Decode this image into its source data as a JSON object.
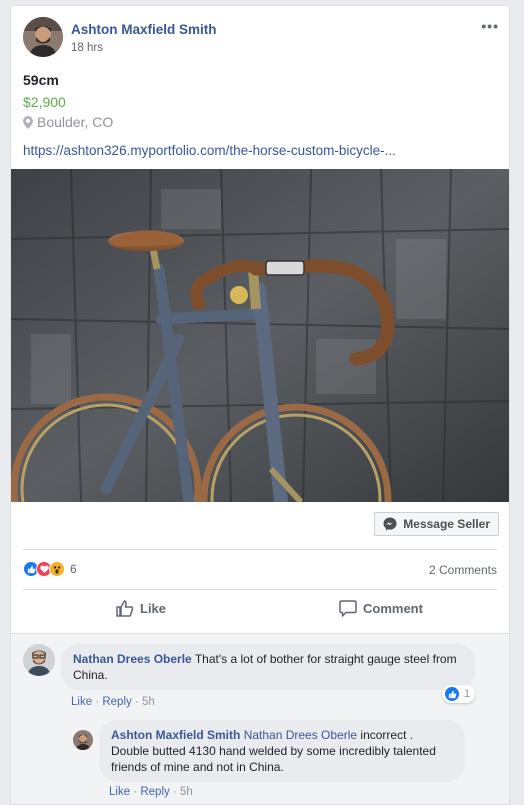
{
  "post": {
    "author": "Ashton Maxfield Smith",
    "time": "18 hrs",
    "more_label": "•••",
    "title": "59cm",
    "price": "$2,900",
    "location": "Boulder, CO",
    "link": "https://ashton326.myportfolio.com/the-horse-custom-bicycle-..."
  },
  "message_seller_label": "Message Seller",
  "reactions": {
    "count": "6",
    "types": [
      "like",
      "love",
      "wow"
    ]
  },
  "comments_count": "2 Comments",
  "actions": {
    "like": "Like",
    "comment": "Comment"
  },
  "comments": [
    {
      "author": "Nathan Drees Oberle",
      "text": "That's a lot of bother for straight gauge steel from China.",
      "like_label": "Like",
      "reply_label": "Reply",
      "time": "5h",
      "like_count": "1"
    }
  ],
  "reply": {
    "author": "Ashton Maxfield Smith",
    "tag": "Nathan Drees Oberle",
    "text_inline": "incorrect .",
    "text_rest": "Double butted 4130 hand welded by some incredibly talented friends of mine and not in China.",
    "like_label": "Like",
    "reply_label": "Reply",
    "time": "5h"
  },
  "colors": {
    "link": "#365899",
    "price": "#5cae4a",
    "like_blue": "#1877f2",
    "love_red": "#f33e58",
    "wow_yellow": "#f7b125"
  }
}
